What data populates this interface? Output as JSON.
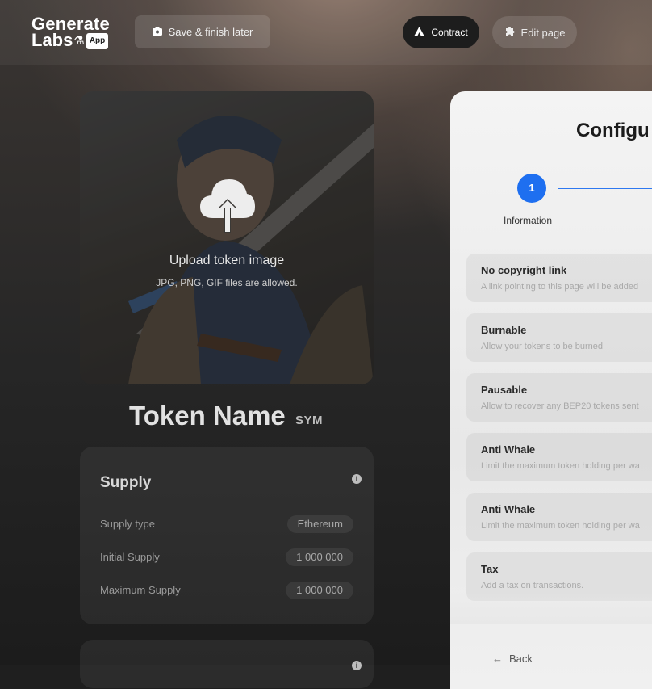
{
  "header": {
    "logo_line1": "Generate",
    "logo_line2": "Labs",
    "logo_badge": "App",
    "save_label": "Save & finish later",
    "contract_label": "Contract",
    "edit_label": "Edit page"
  },
  "upload": {
    "title": "Upload token image",
    "hint": "JPG, PNG, GIF files are allowed."
  },
  "token": {
    "name": "Token Name",
    "symbol": "SYM"
  },
  "supply": {
    "title": "Supply",
    "rows": [
      {
        "label": "Supply type",
        "value": "Ethereum"
      },
      {
        "label": "Initial Supply",
        "value": "1 000 000"
      },
      {
        "label": "Maximum Supply",
        "value": "1 000 000"
      }
    ]
  },
  "panel": {
    "title": "Configu",
    "step_number": "1",
    "step_label": "Information",
    "options": [
      {
        "title": "No copyright link",
        "desc": "A link pointing to this page will be added"
      },
      {
        "title": "Burnable",
        "desc": "Allow your tokens to be burned"
      },
      {
        "title": "Pausable",
        "desc": "Allow to recover any BEP20 tokens sent"
      },
      {
        "title": "Anti Whale",
        "desc": "Limit the maximum token holding per wa"
      },
      {
        "title": "Anti Whale",
        "desc": "Limit the maximum token holding per wa"
      },
      {
        "title": "Tax",
        "desc": "Add a tax on transactions."
      }
    ],
    "back_label": "Back"
  },
  "colors": {
    "accent": "#1e6ff0",
    "dark_button": "#1d1d1d"
  }
}
